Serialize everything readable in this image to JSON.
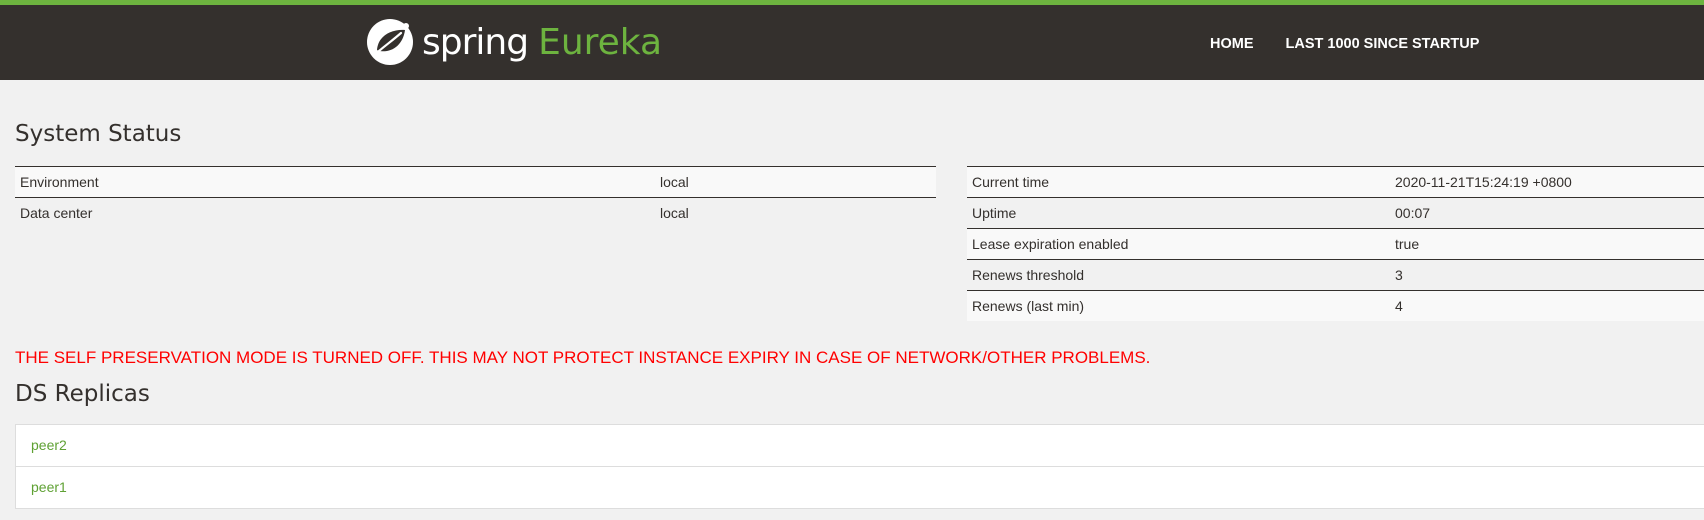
{
  "header": {
    "brand_spring": "spring",
    "brand_eureka": "Eureka",
    "nav": [
      {
        "label": "HOME"
      },
      {
        "label": "LAST 1000 SINCE STARTUP"
      }
    ],
    "colors": {
      "bar": "#34302d",
      "accent": "#6db33f"
    }
  },
  "system_status": {
    "title": "System Status",
    "left": [
      {
        "key": "Environment",
        "value": "local"
      },
      {
        "key": "Data center",
        "value": "local"
      }
    ],
    "right": [
      {
        "key": "Current time",
        "value": "2020-11-21T15:24:19 +0800"
      },
      {
        "key": "Uptime",
        "value": "00:07"
      },
      {
        "key": "Lease expiration enabled",
        "value": "true"
      },
      {
        "key": "Renews threshold",
        "value": "3"
      },
      {
        "key": "Renews (last min)",
        "value": "4"
      }
    ]
  },
  "warning": {
    "text": "THE SELF PRESERVATION MODE IS TURNED OFF. THIS MAY NOT PROTECT INSTANCE EXPIRY IN CASE OF NETWORK/OTHER PROBLEMS.",
    "color": "#ff0000"
  },
  "replicas": {
    "title": "DS Replicas",
    "items": [
      {
        "label": "peer2"
      },
      {
        "label": "peer1"
      }
    ]
  }
}
